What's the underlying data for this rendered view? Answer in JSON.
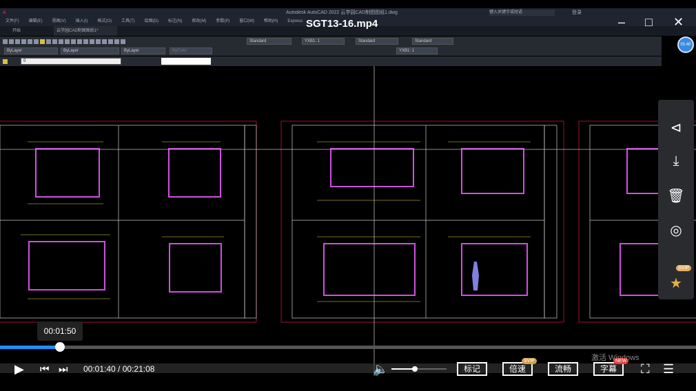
{
  "video": {
    "title": "SGT13-16.mp4",
    "timer_badge": "01:40",
    "current_time": "00:01:40",
    "total_time": "00:21:08",
    "hover_time": "00:01:50",
    "progress_fraction": 0.079,
    "volume_fraction": 0.45
  },
  "acad": {
    "title": "Autodesk AutoCAD 2022  云学园CAD制图图纸1.dwg",
    "search_placeholder": "键入关键字或短语",
    "user": "登录",
    "menu": [
      "文件(F)",
      "编辑(E)",
      "视图(V)",
      "插入(I)",
      "格式(O)",
      "工具(T)",
      "绘图(D)",
      "标注(N)",
      "修改(M)",
      "参数(P)",
      "窗口(W)",
      "帮助(H)",
      "Express"
    ],
    "tabs": [
      "开始",
      "云学园CAD制图图纸1*"
    ],
    "styles": [
      "Standard",
      "YXB1: 1",
      "Standard",
      "Standard",
      "YXB1: 1"
    ],
    "layer_props": [
      "ByLayer",
      "ByLayer",
      "ByLayer",
      "ByColor"
    ],
    "layer": "0"
  },
  "controls": {
    "mark": "标记",
    "speed": "倍速",
    "speed_badge": "SVIP",
    "quality": "流畅",
    "subtitle": "字幕",
    "subtitle_badge": "NEW",
    "pin_badge": "SVIP"
  },
  "watermark": "激活 Windows",
  "colors": {
    "accent": "#1e90ff",
    "magenta": "#d050e0",
    "yellow": "#e8e040",
    "red": "#a01030"
  }
}
